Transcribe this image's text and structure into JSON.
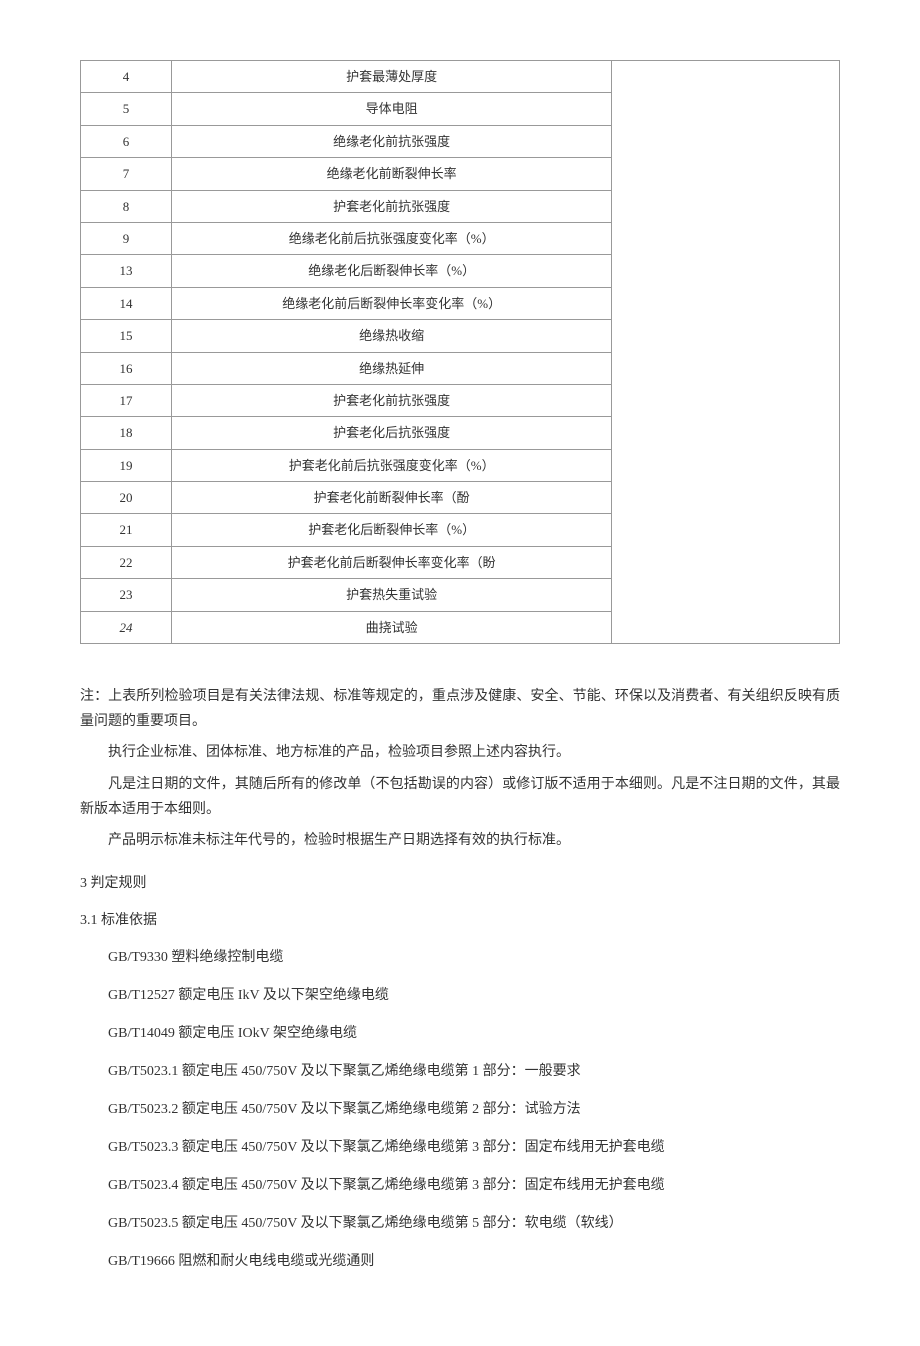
{
  "table": {
    "rows": [
      {
        "num": "4",
        "desc": "护套最薄处厚度"
      },
      {
        "num": "5",
        "desc": "导体电阻"
      },
      {
        "num": "6",
        "desc": "绝缘老化前抗张强度"
      },
      {
        "num": "7",
        "desc": "绝缘老化前断裂伸长率"
      },
      {
        "num": "8",
        "desc": "护套老化前抗张强度"
      },
      {
        "num": "9",
        "desc": "绝缘老化前后抗张强度变化率（%）"
      },
      {
        "num": "13",
        "desc": "绝缘老化后断裂伸长率（%）"
      },
      {
        "num": "14",
        "desc": "绝缘老化前后断裂伸长率变化率（%）"
      },
      {
        "num": "15",
        "desc": "绝缘热收缩"
      },
      {
        "num": "16",
        "desc": "绝缘热延伸"
      },
      {
        "num": "17",
        "desc": "护套老化前抗张强度"
      },
      {
        "num": "18",
        "desc": "护套老化后抗张强度"
      },
      {
        "num": "19",
        "desc": "护套老化前后抗张强度变化率（%）"
      },
      {
        "num": "20",
        "desc": "护套老化前断裂伸长率（酚"
      },
      {
        "num": "21",
        "desc": "护套老化后断裂伸长率（%）"
      },
      {
        "num": "22",
        "desc": "护套老化前后断裂伸长率变化率（盼"
      },
      {
        "num": "23",
        "desc": "护套热失重试验"
      },
      {
        "num": "24",
        "desc": "曲挠试验",
        "italic": true
      }
    ]
  },
  "notes": {
    "n1": "注：上表所列检验项目是有关法律法规、标准等规定的，重点涉及健康、安全、节能、环保以及消费者、有关组织反映有质量问题的重要项目。",
    "n2": "执行企业标准、团体标准、地方标准的产品，检验项目参照上述内容执行。",
    "n3": "凡是注日期的文件，其随后所有的修改单（不包括勘误的内容）或修订版不适用于本细则。凡是不注日期的文件，其最新版本适用于本细则。",
    "n4": "产品明示标准未标注年代号的，检验时根据生产日期选择有效的执行标准。"
  },
  "sections": {
    "s3": "3 判定规则",
    "s3_1": "3.1 标准依据"
  },
  "standards": [
    "GB/T9330 塑料绝缘控制电缆",
    "GB/T12527 额定电压 IkV 及以下架空绝缘电缆",
    "GB/T14049 额定电压 IOkV 架空绝缘电缆",
    "GB/T5023.1 额定电压 450/750V 及以下聚氯乙烯绝缘电缆第 1 部分：一般要求",
    "GB/T5023.2 额定电压 450/750V 及以下聚氯乙烯绝缘电缆第 2 部分：试验方法",
    "GB/T5023.3 额定电压 450/750V 及以下聚氯乙烯绝缘电缆第 3 部分：固定布线用无护套电缆",
    "GB/T5023.4 额定电压 450/750V 及以下聚氯乙烯绝缘电缆第 3 部分：固定布线用无护套电缆",
    "GB/T5023.5 额定电压 450/750V 及以下聚氯乙烯绝缘电缆第 5 部分：软电缆（软线）",
    "GB/T19666 阻燃和耐火电线电缆或光缆通则"
  ]
}
